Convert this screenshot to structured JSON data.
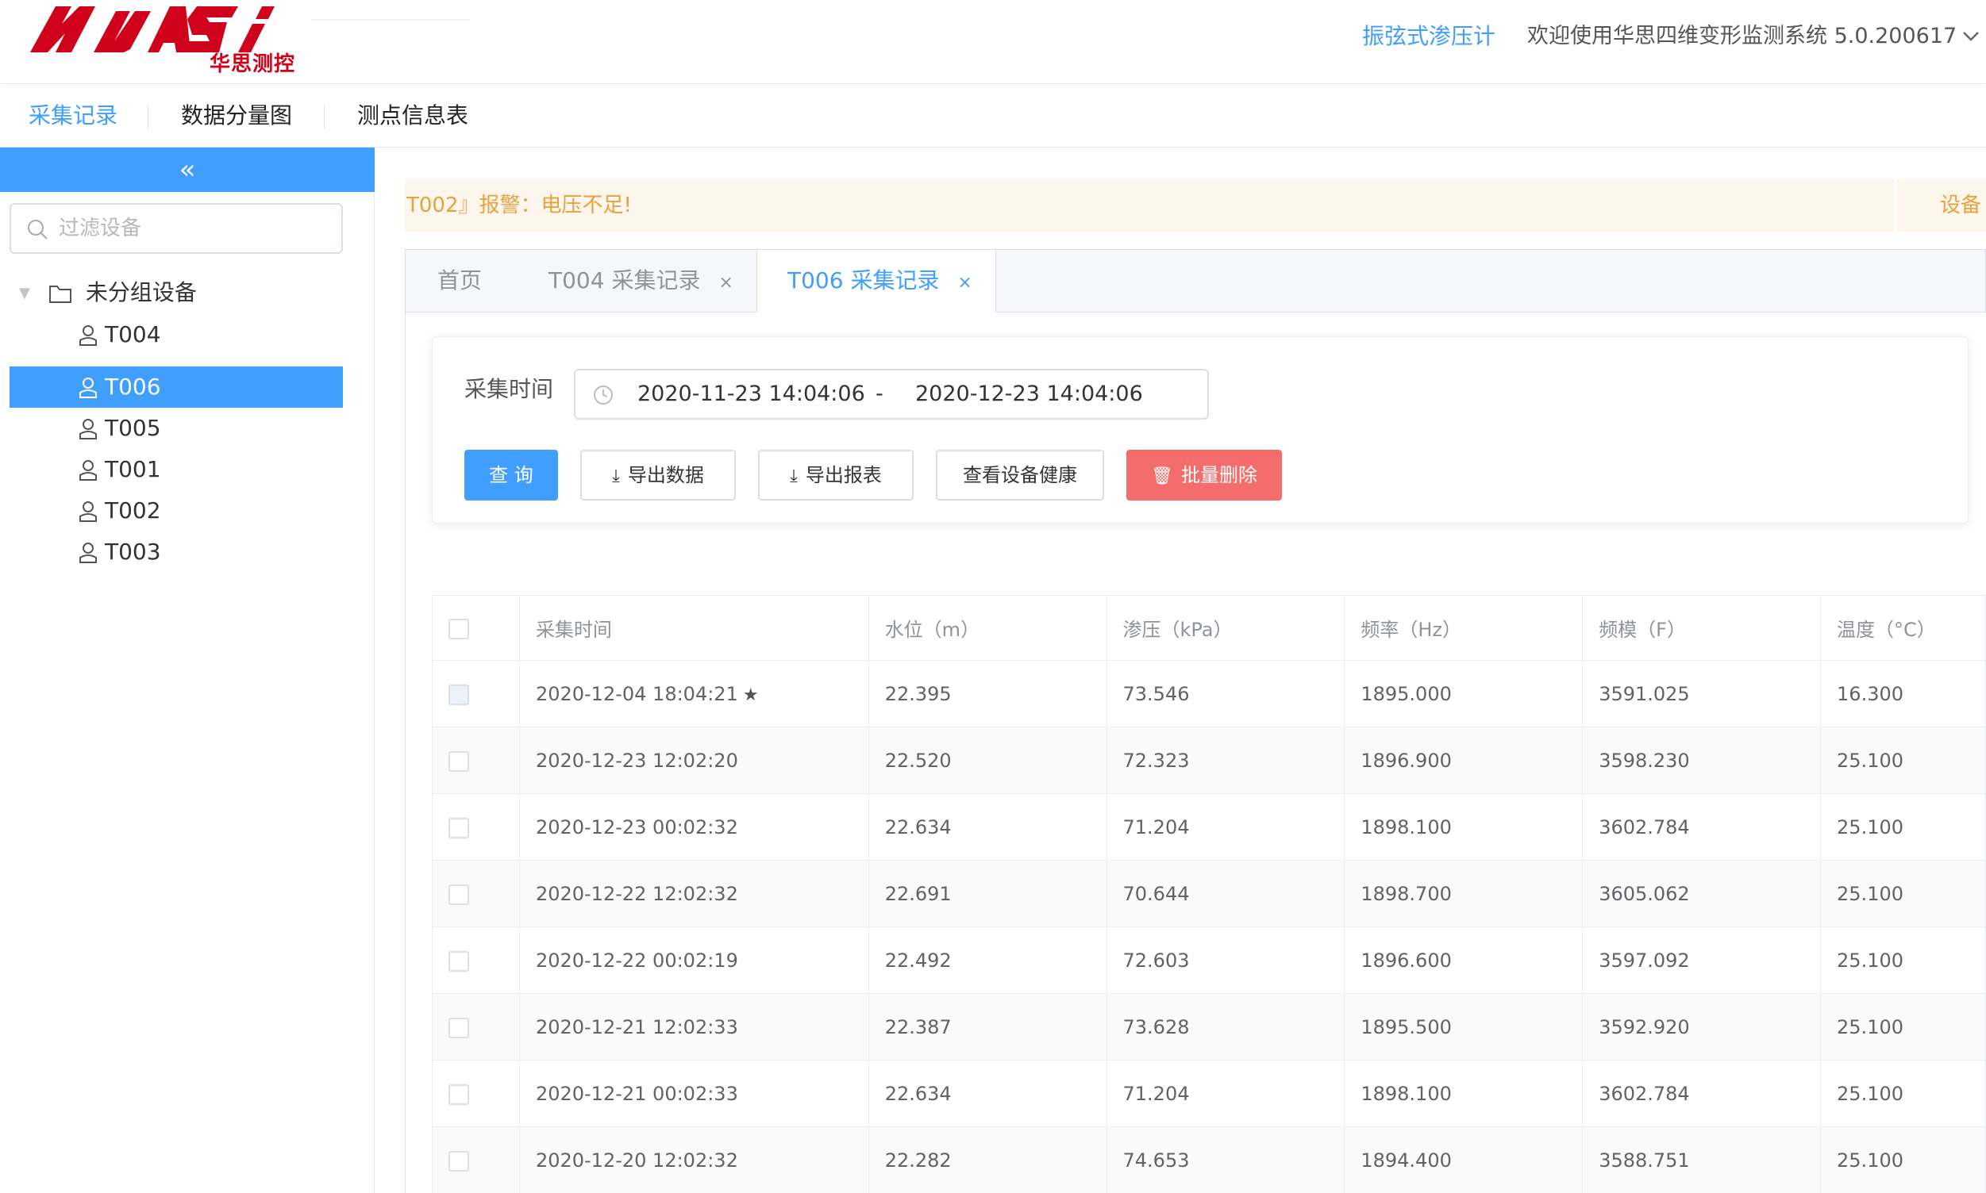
{
  "header": {
    "logo_sub": "华思测控",
    "product_name": "振弦式渗压计",
    "welcome": "欢迎使用华思四维变形监测系统 5.0.200617"
  },
  "nav": {
    "items": [
      {
        "label": "采集记录",
        "active": true
      },
      {
        "label": "数据分量图",
        "active": false
      },
      {
        "label": "测点信息表",
        "active": false
      }
    ]
  },
  "sidebar": {
    "collapse_glyph": "«",
    "filter_placeholder": "过滤设备",
    "group_label": "未分组设备",
    "devices": [
      "T004",
      "T006",
      "T005",
      "T001",
      "T002",
      "T003"
    ],
    "selected": "T006"
  },
  "alert": {
    "text": "T002』报警：电压不足!",
    "right_text": "设备"
  },
  "tabs": {
    "home": "首页",
    "tab1": "T004 采集记录",
    "tab2": "T006 采集记录",
    "close_glyph": "×"
  },
  "query": {
    "label": "采集时间",
    "start": "2020-11-23 14:04:06",
    "separator": "-",
    "end": "2020-12-23 14:04:06",
    "btn_query": "查 询",
    "btn_export_data": "导出数据",
    "btn_export_report": "导出报表",
    "btn_health": "查看设备健康",
    "btn_batch_delete": "批量删除"
  },
  "table": {
    "headers": [
      "采集时间",
      "水位（m）",
      "渗压（kPa）",
      "频率（Hz）",
      "频模（F）",
      "温度（°C）"
    ],
    "rows": [
      {
        "time": "2020-12-04 18:04:21",
        "star": "★",
        "level": "22.395",
        "pressure": "73.546",
        "freq": "1895.000",
        "fmod": "3591.025",
        "temp": "16.300"
      },
      {
        "time": "2020-12-23 12:02:20",
        "star": "",
        "level": "22.520",
        "pressure": "72.323",
        "freq": "1896.900",
        "fmod": "3598.230",
        "temp": "25.100"
      },
      {
        "time": "2020-12-23 00:02:32",
        "star": "",
        "level": "22.634",
        "pressure": "71.204",
        "freq": "1898.100",
        "fmod": "3602.784",
        "temp": "25.100"
      },
      {
        "time": "2020-12-22 12:02:32",
        "star": "",
        "level": "22.691",
        "pressure": "70.644",
        "freq": "1898.700",
        "fmod": "3605.062",
        "temp": "25.100"
      },
      {
        "time": "2020-12-22 00:02:19",
        "star": "",
        "level": "22.492",
        "pressure": "72.603",
        "freq": "1896.600",
        "fmod": "3597.092",
        "temp": "25.100"
      },
      {
        "time": "2020-12-21 12:02:33",
        "star": "",
        "level": "22.387",
        "pressure": "73.628",
        "freq": "1895.500",
        "fmod": "3592.920",
        "temp": "25.100"
      },
      {
        "time": "2020-12-21 00:02:33",
        "star": "",
        "level": "22.634",
        "pressure": "71.204",
        "freq": "1898.100",
        "fmod": "3602.784",
        "temp": "25.100"
      },
      {
        "time": "2020-12-20 12:02:32",
        "star": "",
        "level": "22.282",
        "pressure": "74.653",
        "freq": "1894.400",
        "fmod": "3588.751",
        "temp": "25.100"
      }
    ]
  },
  "colors": {
    "primary": "#409eff",
    "danger": "#f56c6c",
    "warning_bg": "#fdf6ec",
    "warning_text": "#e6a23c",
    "logo_red": "#d0021b"
  }
}
